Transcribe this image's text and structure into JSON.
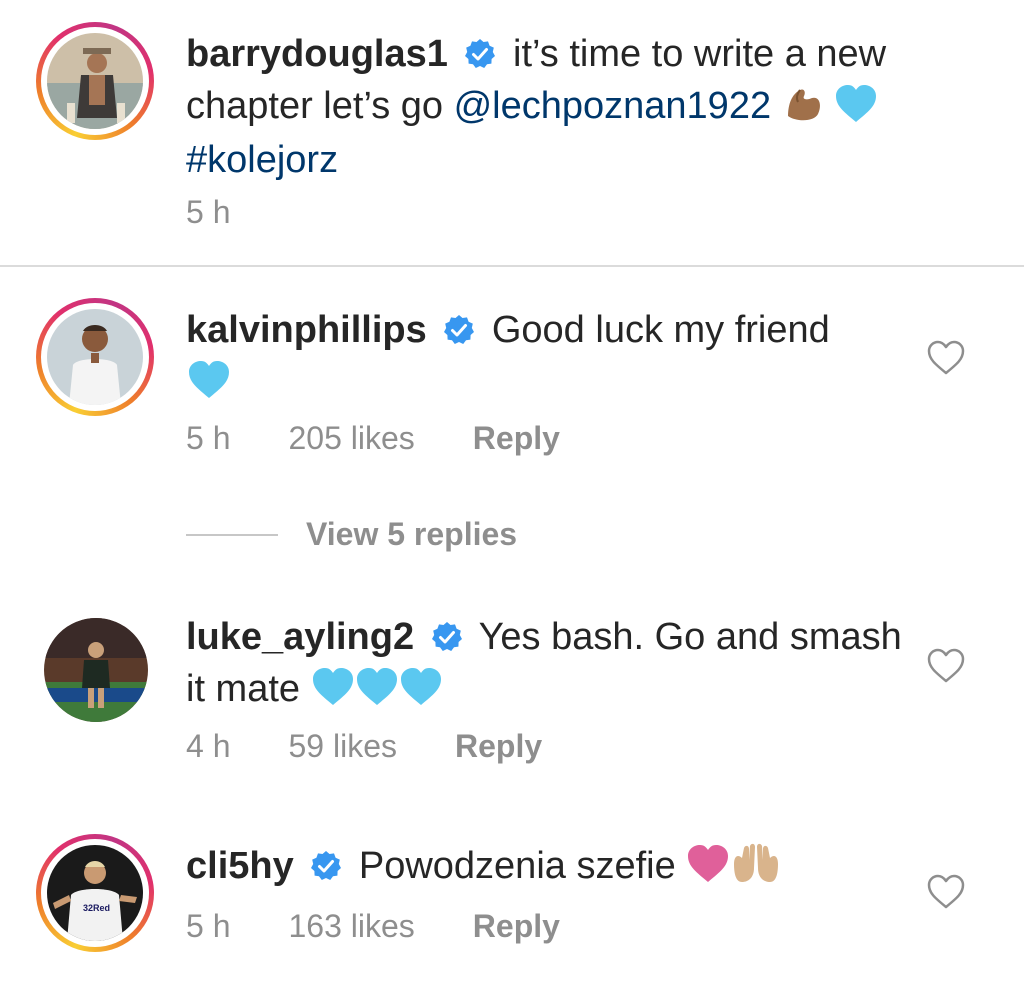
{
  "caption": {
    "username": "barrydouglas1",
    "text_1": "it’s time to write a new chapter let’s go",
    "mention": "@lechpoznan1922",
    "hashtag": "#kolejorz",
    "time": "5 h",
    "emoji_muscle": "flexed-biceps-emoji",
    "emoji_heart": "blue-heart-emoji"
  },
  "comments": [
    {
      "username": "kalvinphillips",
      "text": "Good luck my friend",
      "time": "5 h",
      "likes": "205 likes",
      "reply": "Reply",
      "view_replies": "View 5 replies"
    },
    {
      "username": "luke_ayling2",
      "text": "Yes bash. Go and smash it mate",
      "time": "4 h",
      "likes": "59 likes",
      "reply": "Reply"
    },
    {
      "username": "cli5hy",
      "text": "Powodzenia szefie",
      "time": "5 h",
      "likes": "163 likes",
      "reply": "Reply"
    }
  ],
  "colors": {
    "text": "#262626",
    "secondary": "#8e8e8e",
    "link": "#00376b",
    "verified": "#3897f0",
    "blue_heart": "#5bc8f0",
    "pink_heart": "#e0609a"
  }
}
